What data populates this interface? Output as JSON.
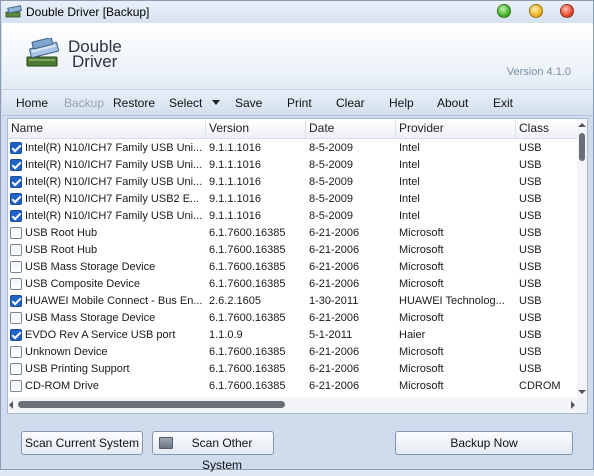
{
  "window": {
    "title": "Double Driver [Backup]"
  },
  "header": {
    "logo_line1": "Double",
    "logo_line2": "Driver",
    "version": "Version 4.1.0"
  },
  "toolbar": {
    "items": [
      {
        "label": "Home",
        "enabled": true
      },
      {
        "label": "Backup",
        "enabled": false
      },
      {
        "label": "Restore",
        "enabled": true
      },
      {
        "label": "Select",
        "enabled": true
      },
      {
        "label": "Save",
        "enabled": true
      },
      {
        "label": "Print",
        "enabled": true
      },
      {
        "label": "Clear",
        "enabled": true
      },
      {
        "label": "Help",
        "enabled": true
      },
      {
        "label": "About",
        "enabled": true
      },
      {
        "label": "Exit",
        "enabled": true
      }
    ]
  },
  "table": {
    "columns": [
      "Name",
      "Version",
      "Date",
      "Provider",
      "Class"
    ],
    "rows": [
      {
        "checked": true,
        "name": "Intel(R) N10/ICH7 Family USB Uni...",
        "version": "9.1.1.1016",
        "date": "8-5-2009",
        "provider": "Intel",
        "class": "USB"
      },
      {
        "checked": true,
        "name": "Intel(R) N10/ICH7 Family USB Uni...",
        "version": "9.1.1.1016",
        "date": "8-5-2009",
        "provider": "Intel",
        "class": "USB"
      },
      {
        "checked": true,
        "name": "Intel(R) N10/ICH7 Family USB Uni...",
        "version": "9.1.1.1016",
        "date": "8-5-2009",
        "provider": "Intel",
        "class": "USB"
      },
      {
        "checked": true,
        "name": "Intel(R) N10/ICH7 Family USB2 E...",
        "version": "9.1.1.1016",
        "date": "8-5-2009",
        "provider": "Intel",
        "class": "USB"
      },
      {
        "checked": true,
        "name": "Intel(R) N10/ICH7 Family USB Uni...",
        "version": "9.1.1.1016",
        "date": "8-5-2009",
        "provider": "Intel",
        "class": "USB"
      },
      {
        "checked": false,
        "name": "USB Root Hub",
        "version": "6.1.7600.16385",
        "date": "6-21-2006",
        "provider": "Microsoft",
        "class": "USB"
      },
      {
        "checked": false,
        "name": "USB Root Hub",
        "version": "6.1.7600.16385",
        "date": "6-21-2006",
        "provider": "Microsoft",
        "class": "USB"
      },
      {
        "checked": false,
        "name": "USB Mass Storage Device",
        "version": "6.1.7600.16385",
        "date": "6-21-2006",
        "provider": "Microsoft",
        "class": "USB"
      },
      {
        "checked": false,
        "name": "USB Composite Device",
        "version": "6.1.7600.16385",
        "date": "6-21-2006",
        "provider": "Microsoft",
        "class": "USB"
      },
      {
        "checked": true,
        "name": "HUAWEI Mobile Connect - Bus En...",
        "version": "2.6.2.1605",
        "date": "1-30-2011",
        "provider": "HUAWEI Technolog...",
        "class": "USB"
      },
      {
        "checked": false,
        "name": "USB Mass Storage Device",
        "version": "6.1.7600.16385",
        "date": "6-21-2006",
        "provider": "Microsoft",
        "class": "USB"
      },
      {
        "checked": true,
        "name": "EVDO Rev A Service USB port",
        "version": "1.1.0.9",
        "date": "5-1-2011",
        "provider": "Haier",
        "class": "USB"
      },
      {
        "checked": false,
        "name": "Unknown Device",
        "version": "6.1.7600.16385",
        "date": "6-21-2006",
        "provider": "Microsoft",
        "class": "USB"
      },
      {
        "checked": false,
        "name": "USB Printing Support",
        "version": "6.1.7600.16385",
        "date": "6-21-2006",
        "provider": "Microsoft",
        "class": "USB"
      },
      {
        "checked": false,
        "name": "CD-ROM Drive",
        "version": "6.1.7600.16385",
        "date": "6-21-2006",
        "provider": "Microsoft",
        "class": "CDROM"
      }
    ]
  },
  "buttons": {
    "scan_current": "Scan Current System",
    "scan_other": "Scan Other System",
    "backup_now": "Backup Now"
  }
}
